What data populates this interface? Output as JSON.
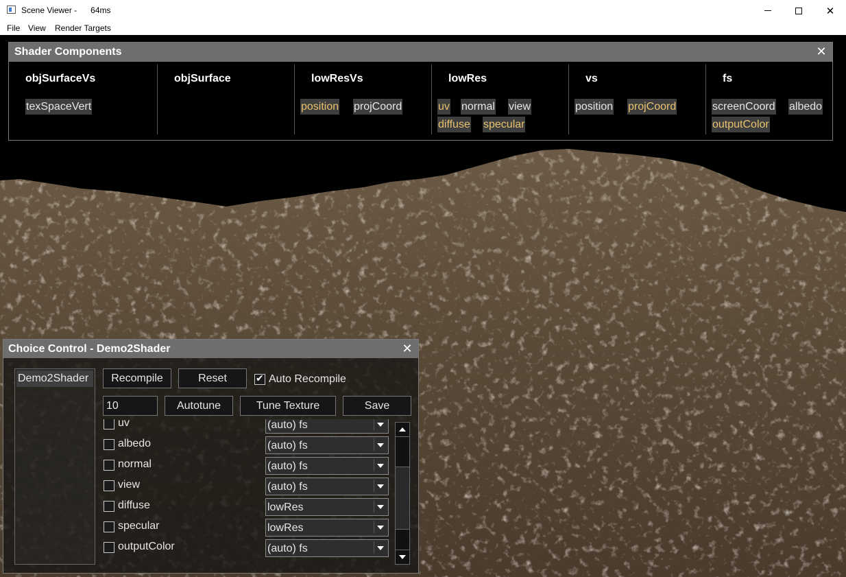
{
  "window": {
    "title": "Scene Viewer -      64ms",
    "minimize_icon": "minimize-icon",
    "maximize_icon": "maximize-icon",
    "close_label": "✕"
  },
  "menu": {
    "items": [
      "File",
      "View",
      "Render Targets"
    ]
  },
  "shader_components": {
    "title": "Shader Components",
    "close_label": "✕",
    "highlight_color": "#e8c26e",
    "columns": [
      {
        "name": "objSurfaceVs",
        "chips": [
          {
            "label": "texSpaceVert",
            "highlighted": false
          }
        ]
      },
      {
        "name": "objSurface",
        "chips": []
      },
      {
        "name": "lowResVs",
        "chips": [
          {
            "label": "position",
            "highlighted": true
          },
          {
            "label": "projCoord",
            "highlighted": false
          }
        ]
      },
      {
        "name": "lowRes",
        "chips": [
          {
            "label": "uv",
            "highlighted": true
          },
          {
            "label": "normal",
            "highlighted": false
          },
          {
            "label": "view",
            "highlighted": false
          },
          {
            "label": "diffuse",
            "highlighted": true
          },
          {
            "label": "specular",
            "highlighted": true
          }
        ]
      },
      {
        "name": "vs",
        "chips": [
          {
            "label": "position",
            "highlighted": false
          },
          {
            "label": "projCoord",
            "highlighted": true
          }
        ]
      },
      {
        "name": "fs",
        "chips": [
          {
            "label": "screenCoord",
            "highlighted": false
          },
          {
            "label": "albedo",
            "highlighted": false
          },
          {
            "label": "outputColor",
            "highlighted": true
          }
        ]
      }
    ]
  },
  "choice_control": {
    "title": "Choice Control - Demo2Shader",
    "close_label": "✕",
    "shader_list": [
      "Demo2Shader"
    ],
    "recompile_label": "Recompile",
    "reset_label": "Reset",
    "auto_recompile_label": "Auto Recompile",
    "auto_recompile_checked": true,
    "checkmark": "✔",
    "iterations_value": "10",
    "autotune_label": "Autotune",
    "tune_texture_label": "Tune Texture",
    "save_label": "Save",
    "rows": [
      {
        "name": "uv",
        "checked": false,
        "choice": "(auto) fs"
      },
      {
        "name": "albedo",
        "checked": false,
        "choice": "(auto) fs"
      },
      {
        "name": "normal",
        "checked": false,
        "choice": "(auto) fs"
      },
      {
        "name": "view",
        "checked": false,
        "choice": "(auto) fs"
      },
      {
        "name": "diffuse",
        "checked": false,
        "choice": "lowRes"
      },
      {
        "name": "specular",
        "checked": false,
        "choice": "lowRes"
      },
      {
        "name": "outputColor",
        "checked": false,
        "choice": "(auto) fs"
      }
    ]
  }
}
